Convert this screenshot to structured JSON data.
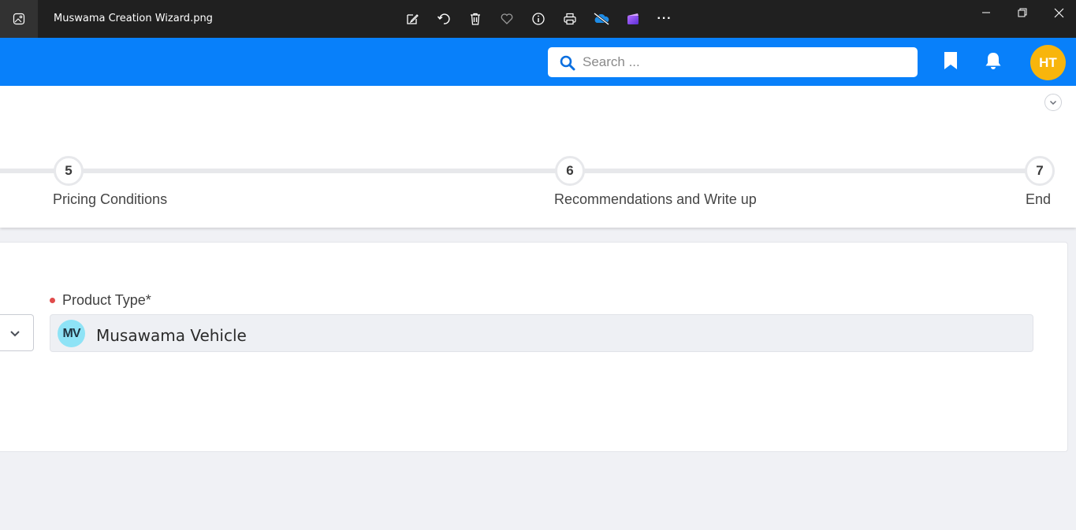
{
  "viewer": {
    "file_name": "Muswama Creation Wizard.png",
    "toolbar_icons": [
      "edit-image-icon",
      "rotate-icon",
      "delete-icon",
      "favorite-icon",
      "info-icon",
      "print-icon",
      "onedrive-icon",
      "clipchamp-icon",
      "more-icon"
    ],
    "more_label": "···"
  },
  "header": {
    "search": {
      "placeholder": "Search ..."
    },
    "user_initials": "HT",
    "colors": {
      "brand": "#0880fa",
      "avatar": "#f8b50c"
    }
  },
  "stepper": {
    "steps": [
      {
        "number": "5",
        "label": "Pricing Conditions"
      },
      {
        "number": "6",
        "label": "Recommendations and Write up"
      },
      {
        "number": "7",
        "label": "End"
      }
    ]
  },
  "form": {
    "product_type": {
      "label": "Product Type*",
      "badge": "MV",
      "value": "Musawama Vehicle"
    }
  }
}
